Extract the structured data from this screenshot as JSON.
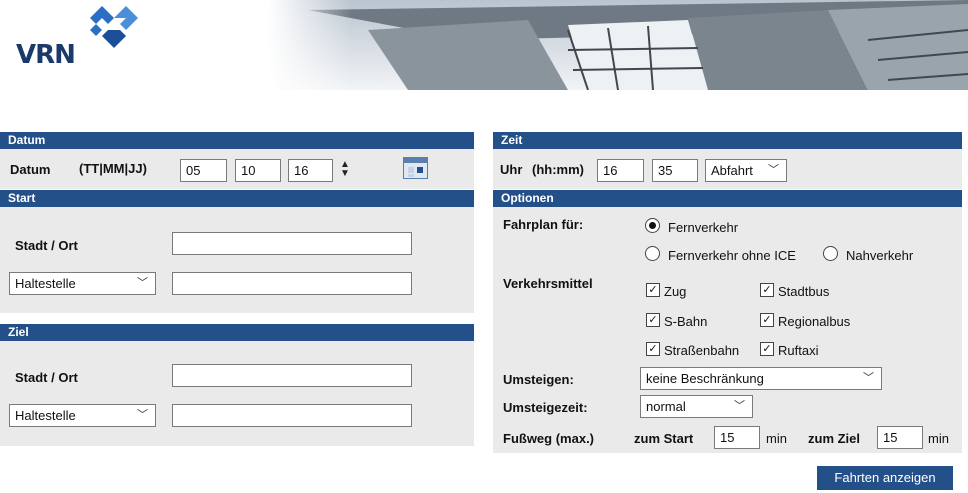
{
  "header": {
    "logo_text": "VRN"
  },
  "datum": {
    "section_title": "Datum",
    "label": "Datum",
    "format_hint": "(TT|MM|JJ)",
    "day": "05",
    "month": "10",
    "year": "16"
  },
  "start": {
    "section_title": "Start",
    "city_label": "Stadt / Ort",
    "city_value": "",
    "type_select": "Haltestelle",
    "stop_value": ""
  },
  "ziel": {
    "section_title": "Ziel",
    "city_label": "Stadt / Ort",
    "city_value": "",
    "type_select": "Haltestelle",
    "stop_value": ""
  },
  "zeit": {
    "section_title": "Zeit",
    "label": "Uhr",
    "format_hint": "(hh:mm)",
    "hour": "16",
    "minute": "35",
    "mode_select": "Abfahrt"
  },
  "optionen": {
    "section_title": "Optionen",
    "fahrplan_label": "Fahrplan für:",
    "radio_fernverkehr": "Fernverkehr",
    "radio_fern_ohne_ice": "Fernverkehr ohne ICE",
    "radio_nahverkehr": "Nahverkehr",
    "selected_radio": "Fernverkehr",
    "verkehrsmittel_label": "Verkehrsmittel",
    "check_zug": "Zug",
    "check_stadtbus": "Stadtbus",
    "check_sbahn": "S-Bahn",
    "check_regionalbus": "Regionalbus",
    "check_strassenbahn": "Straßenbahn",
    "check_ruftaxi": "Ruftaxi",
    "umsteigen_label": "Umsteigen:",
    "umsteigen_value": "keine Beschränkung",
    "umsteigezeit_label": "Umsteigezeit:",
    "umsteigezeit_value": "normal",
    "fussweg_label": "Fußweg (max.)",
    "zum_start_label": "zum Start",
    "zum_start_value": "15",
    "zum_ziel_label": "zum Ziel",
    "zum_ziel_value": "15",
    "min_unit": "min"
  },
  "submit_label": "Fahrten anzeigen",
  "colors": {
    "bar": "#24508a",
    "panel": "#eaeaea",
    "logo": "#1b3a6b"
  }
}
